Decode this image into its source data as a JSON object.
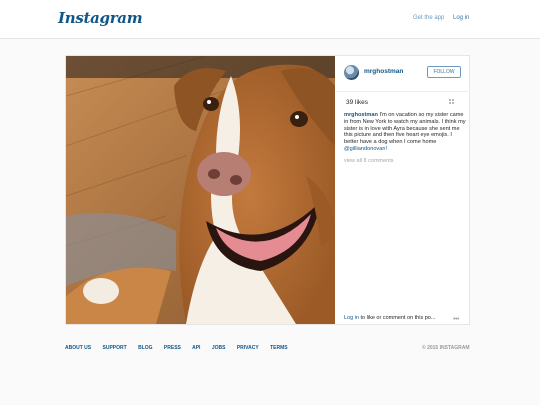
{
  "header": {
    "logo": "Instagram",
    "get_app": "Get the app",
    "login": "Log in"
  },
  "post": {
    "username": "mrghostman",
    "follow_label": "FOLLOW",
    "likes": "39 likes",
    "caption_user": "mrghostman",
    "caption_text": " I'm on vacation so my sister came in from New York to watch my animals. I think my sister is in love with Ayra because she sent me this picture and then five heart eye emojis. I better have a dog when I come home ",
    "caption_mention": "@gilliandonovan!",
    "view_all": "view all 8 comments",
    "login_link": "Log in",
    "login_suffix": " to like or comment on this po...",
    "more_icon": "more-icon",
    "photo_subject": "smiling brown and white dog on wooden floor"
  },
  "footer": {
    "links": [
      "ABOUT US",
      "SUPPORT",
      "BLOG",
      "PRESS",
      "API",
      "JOBS",
      "PRIVACY",
      "TERMS"
    ],
    "copyright": "© 2015 INSTAGRAM"
  },
  "colors": {
    "brand": "#125688",
    "link": "#3f729b",
    "muted": "#a5a7aa",
    "background": "#fafafa"
  }
}
